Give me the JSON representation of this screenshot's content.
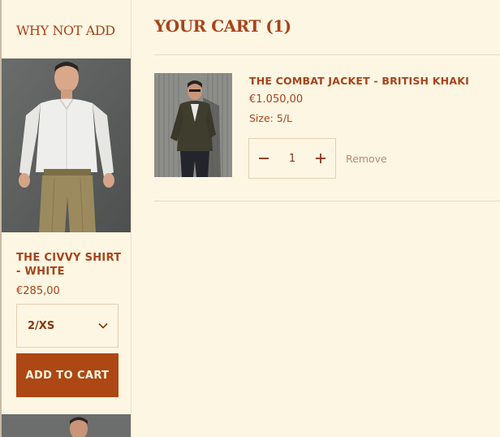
{
  "upsell": {
    "title": "WHY NOT ADD",
    "product": {
      "name": "THE CIVVY SHIRT - WHITE",
      "price": "€285,00",
      "size_selected": "2/XS",
      "add_label": "ADD TO CART"
    }
  },
  "cart": {
    "title": "YOUR CART (1)",
    "items": [
      {
        "name": "THE COMBAT JACKET - BRITISH KHAKI",
        "price": "€1.050,00",
        "size_label": "Size:",
        "size_value": "5/L",
        "quantity": "1",
        "remove_label": "Remove"
      }
    ]
  },
  "icons": {
    "size_dropdown": "chevron-down-icon",
    "qty_decrease": "minus-icon",
    "qty_increase": "plus-icon"
  },
  "colors": {
    "background": "#fdf6e3",
    "accent": "#a8431a",
    "button": "#ad4713",
    "muted": "#b88b6f"
  }
}
